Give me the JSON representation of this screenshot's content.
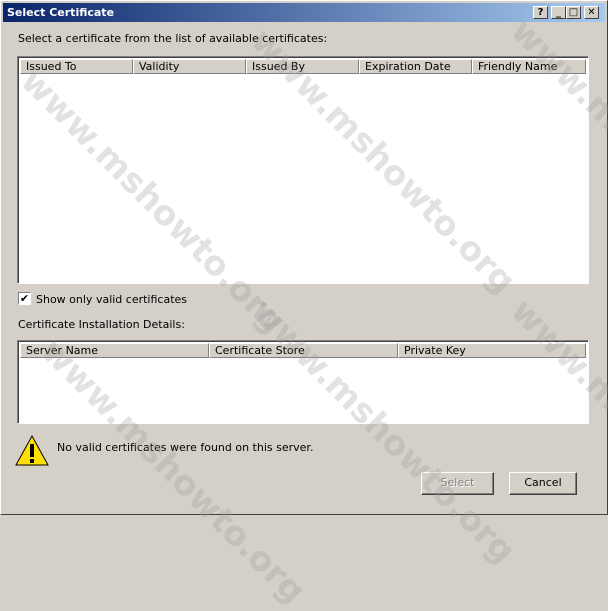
{
  "window": {
    "title": "Select Certificate",
    "help_btn": "?",
    "min_btn": "_",
    "max_btn": "□",
    "close_btn": "✕"
  },
  "instructions": "Select a certificate from the list of available certificates:",
  "certificates_table": {
    "columns": [
      "Issued To",
      "Validity",
      "Issued By",
      "Expiration Date",
      "Friendly Name"
    ],
    "rows": []
  },
  "show_valid_checkbox": {
    "label": "Show only valid certificates",
    "checked": true
  },
  "installation_details": {
    "label": "Certificate Installation Details:",
    "columns": [
      "Server Name",
      "Certificate Store",
      "Private Key"
    ],
    "rows": []
  },
  "warning_message": "No valid certificates were found on this server.",
  "buttons": {
    "select": "Select",
    "cancel": "Cancel"
  },
  "watermark": "www.mshowto.org"
}
